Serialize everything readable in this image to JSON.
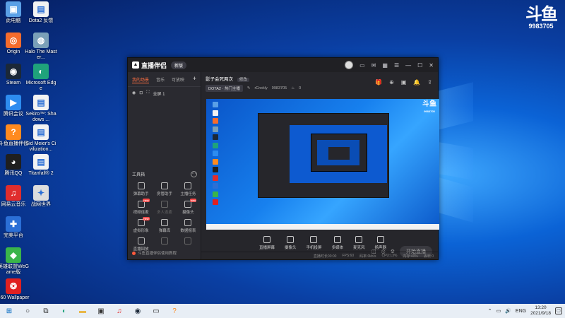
{
  "desktop": {
    "icons": [
      {
        "label": "此电脑",
        "icon": "computer-icon",
        "color": "#5aa0e6"
      },
      {
        "label": "Dota2 反馈",
        "icon": "document-icon",
        "color": "#f2f2f2"
      },
      {
        "label": "Origin",
        "icon": "origin-icon",
        "color": "#f56c2d"
      },
      {
        "label": "Halo The Master...",
        "icon": "halo-icon",
        "color": "#7aa0b8"
      },
      {
        "label": "Steam",
        "icon": "steam-icon",
        "color": "#1b2838"
      },
      {
        "label": "Microsoft Edge",
        "icon": "edge-icon",
        "color": "#1fa37b"
      },
      {
        "label": "腾讯会议",
        "icon": "meeting-icon",
        "color": "#2d8cf0"
      },
      {
        "label": "Sekiro™: Shadows ...",
        "icon": "document-icon",
        "color": "#f2f2f2"
      },
      {
        "label": "斗鱼直播伴侣",
        "icon": "douyu-icon",
        "color": "#ff8a1f"
      },
      {
        "label": "Sid Meier's Civilization...",
        "icon": "document-icon",
        "color": "#f2f2f2"
      },
      {
        "label": "腾讯QQ",
        "icon": "qq-icon",
        "color": "#1f1f1f"
      },
      {
        "label": "Titanfall® 2",
        "icon": "document-icon",
        "color": "#f2f2f2"
      },
      {
        "label": "网易云音乐",
        "icon": "netease-music-icon",
        "color": "#e02d2d"
      },
      {
        "label": "战网世界",
        "icon": "game-icon",
        "color": "#dddddd"
      },
      {
        "label": "完美平台",
        "icon": "platform-icon",
        "color": "#2b6fd6"
      },
      {
        "label": "英雄联盟WeGame版",
        "icon": "wegame-icon",
        "color": "#3ab44a"
      },
      {
        "label": "360 Wallpaper",
        "icon": "wallpaper-icon",
        "color": "#e02020"
      }
    ]
  },
  "watermark": {
    "logo": "斗鱼",
    "room_number": "9983705"
  },
  "app": {
    "brand": "直播伴侣",
    "version_tag": "新版",
    "left_tabs": [
      "我的场景",
      "音乐",
      "可放映"
    ],
    "scene_label": "全屏 1",
    "tools_header": "工具箱",
    "tools": [
      {
        "label": "弹幕助手",
        "dim": false,
        "badge": ""
      },
      {
        "label": "房管助手",
        "dim": false,
        "badge": ""
      },
      {
        "label": "主播任务",
        "dim": false,
        "badge": ""
      },
      {
        "label": "视频连麦",
        "dim": false,
        "badge": "new"
      },
      {
        "label": "多人连麦",
        "dim": true,
        "badge": ""
      },
      {
        "label": "摄像头",
        "dim": false,
        "badge": "new"
      },
      {
        "label": "虚拟形象",
        "dim": false,
        "badge": "new"
      },
      {
        "label": "弹幕库",
        "dim": false,
        "badge": ""
      },
      {
        "label": "数据报表",
        "dim": false,
        "badge": ""
      },
      {
        "label": "直播回放",
        "dim": false,
        "badge": ""
      },
      {
        "label": "",
        "dim": true,
        "badge": ""
      },
      {
        "label": "",
        "dim": true,
        "badge": ""
      }
    ],
    "left_footer": "斗鱼直播伴侣使用教程",
    "room_title": "影子会死两次",
    "edit_label": "修改",
    "category": "DOTA2 · 热门主播",
    "streamer": "rCnxkly",
    "room_id": "9983705",
    "hot_count": "0",
    "controls": [
      {
        "label": "直播屏幕",
        "icon": "screen-icon"
      },
      {
        "label": "摄像头",
        "icon": "camera-icon"
      },
      {
        "label": "手机投屏",
        "icon": "phone-icon"
      },
      {
        "label": "多媒体",
        "icon": "media-icon"
      },
      {
        "label": "麦克风",
        "icon": "mic-icon"
      },
      {
        "label": "扬声器",
        "icon": "speaker-icon"
      }
    ],
    "start_button": "开始直播",
    "status": [
      "直播时长00:00",
      "FPS:60",
      "码率:0kb/s",
      "CPU:13%",
      "内存:40%",
      "丢帧:0"
    ]
  },
  "taskbar": {
    "apps": [
      "start-icon",
      "search-icon",
      "task-view-icon",
      "edge-icon",
      "folder-icon",
      "store-icon",
      "netease-music-icon",
      "steam-icon",
      "monitor-icon",
      "douyu-icon"
    ],
    "lang": "ENG",
    "time": "13:20",
    "date": "2021/9/18"
  }
}
